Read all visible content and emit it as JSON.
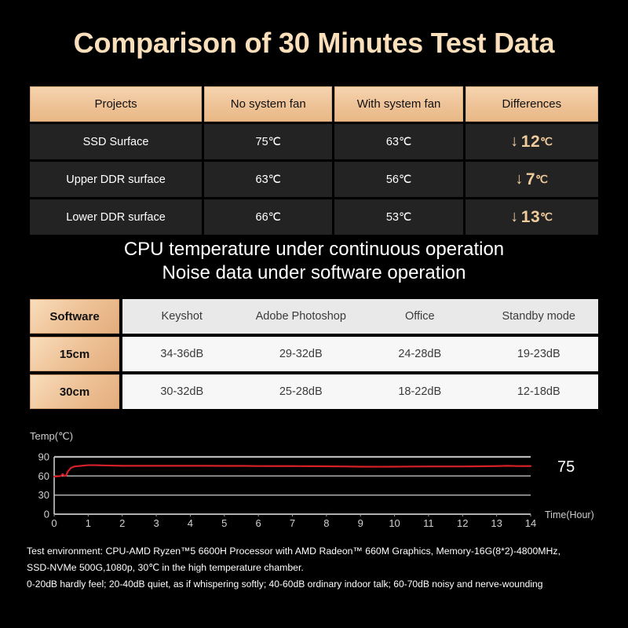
{
  "title": "Comparison of 30 Minutes Test Data",
  "temp_table": {
    "headers": [
      "Projects",
      "No system fan",
      "With system fan",
      "Differences"
    ],
    "rows": [
      {
        "project": "SSD Surface",
        "no_fan": "75℃",
        "with_fan": "63℃",
        "diff_arrow": "↓",
        "diff_value": "12",
        "diff_unit": "℃"
      },
      {
        "project": "Upper DDR surface",
        "no_fan": "63℃",
        "with_fan": "56℃",
        "diff_arrow": "↓",
        "diff_value": "7",
        "diff_unit": "℃"
      },
      {
        "project": "Lower DDR surface",
        "no_fan": "66℃",
        "with_fan": "53℃",
        "diff_arrow": "↓",
        "diff_value": "13",
        "diff_unit": "℃"
      }
    ]
  },
  "mid_heading": {
    "line1": "CPU temperature under continuous operation",
    "line2": "Noise data under software operation"
  },
  "noise_table": {
    "headers": [
      "Software",
      "Keyshot",
      "Adobe Photoshop",
      "Office",
      "Standby mode"
    ],
    "rows": [
      {
        "distance": "15cm",
        "values": [
          "34-36dB",
          "29-32dB",
          "24-28dB",
          "19-23dB"
        ]
      },
      {
        "distance": "30cm",
        "values": [
          "30-32dB",
          "25-28dB",
          "18-22dB",
          "12-18dB"
        ]
      }
    ]
  },
  "chart_data": {
    "type": "line",
    "title": "",
    "ylabel": "Temp(℃)",
    "xlabel": "Time(Hour)",
    "ylim": [
      0,
      90
    ],
    "xlim": [
      0,
      14
    ],
    "yticks": [
      0,
      30,
      60,
      90
    ],
    "xticks": [
      0,
      1,
      2,
      3,
      4,
      5,
      6,
      7,
      8,
      9,
      10,
      11,
      12,
      13,
      14
    ],
    "grid": true,
    "legend": "none",
    "end_label": "75",
    "line_color": "#d62028",
    "series": [
      {
        "name": "CPU temperature",
        "x": [
          0,
          0.1,
          0.2,
          0.25,
          0.3,
          0.35,
          0.4,
          0.5,
          0.6,
          0.8,
          1.0,
          1.2,
          1.5,
          2.0,
          2.5,
          3.0,
          3.5,
          4.0,
          4.5,
          5.0,
          5.5,
          6.0,
          6.5,
          7.0,
          7.5,
          8.0,
          8.5,
          9.0,
          9.5,
          10.0,
          10.5,
          11.0,
          11.5,
          12.0,
          12.5,
          13.0,
          13.3,
          13.6,
          14.0
        ],
        "y": [
          59,
          59.5,
          60,
          63,
          60,
          60.5,
          67,
          73,
          75,
          76,
          77,
          77,
          76.5,
          76,
          76,
          76,
          76,
          76,
          76,
          75.8,
          75.8,
          75.6,
          75.5,
          75.5,
          75.4,
          75.2,
          75,
          74.6,
          74.5,
          74.6,
          74.8,
          75,
          75,
          75,
          75.2,
          75.5,
          76,
          75.6,
          75.5
        ]
      }
    ]
  },
  "footer": {
    "line1": "Test environment: CPU-AMD Ryzen™5 6600H Processor with AMD Radeon™ 660M Graphics,  Memory-16G(8*2)-4800MHz,",
    "line2": "SSD-NVMe 500G,1080p, 30℃ in the high temperature chamber.",
    "line3": "0-20dB hardly feel; 20-40dB quiet, as if whispering softly; 40-60dB ordinary indoor talk; 60-70dB noisy and nerve-wounding"
  },
  "colors": {
    "background": "#000000",
    "accent_peach": "#efc49a",
    "title_cream": "#fbdfbb",
    "row_dark": "#232323",
    "noise_header": "#e9e9e9",
    "noise_body": "#f7f7f7",
    "chart_line": "#d62028"
  }
}
